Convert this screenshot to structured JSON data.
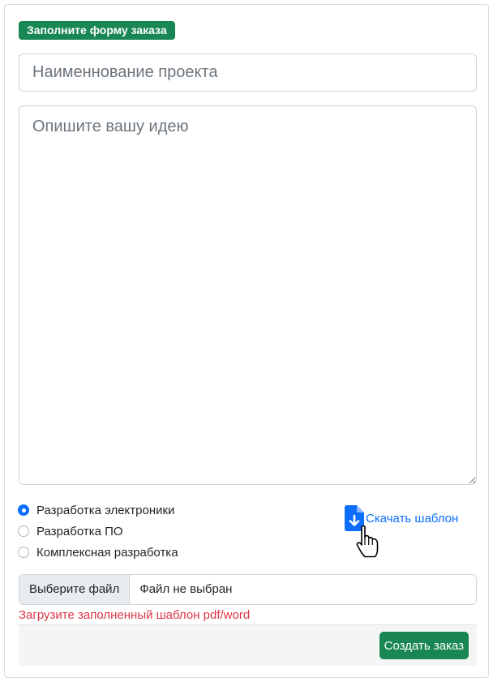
{
  "form": {
    "badge": "Заполните форму заказа",
    "project_name": {
      "placeholder": "Наименнование проекта",
      "value": ""
    },
    "idea": {
      "placeholder": "Опишите вашу идею",
      "value": ""
    },
    "options": [
      {
        "label": "Разработка электроники",
        "checked": true
      },
      {
        "label": "Разработка ПО",
        "checked": false
      },
      {
        "label": "Комплексная разработка",
        "checked": false
      }
    ],
    "download_template": {
      "label": "Скачать шаблон",
      "icon": "file-download-icon"
    },
    "file": {
      "button_label": "Выберите файл",
      "status": "Файл не выбран"
    },
    "helper": "Загрузите заполненный шаблон pdf/word",
    "submit_label": "Создать заказ"
  },
  "colors": {
    "accent_green": "#198754",
    "link_blue": "#0d6efd",
    "error_red": "#dc3545"
  }
}
